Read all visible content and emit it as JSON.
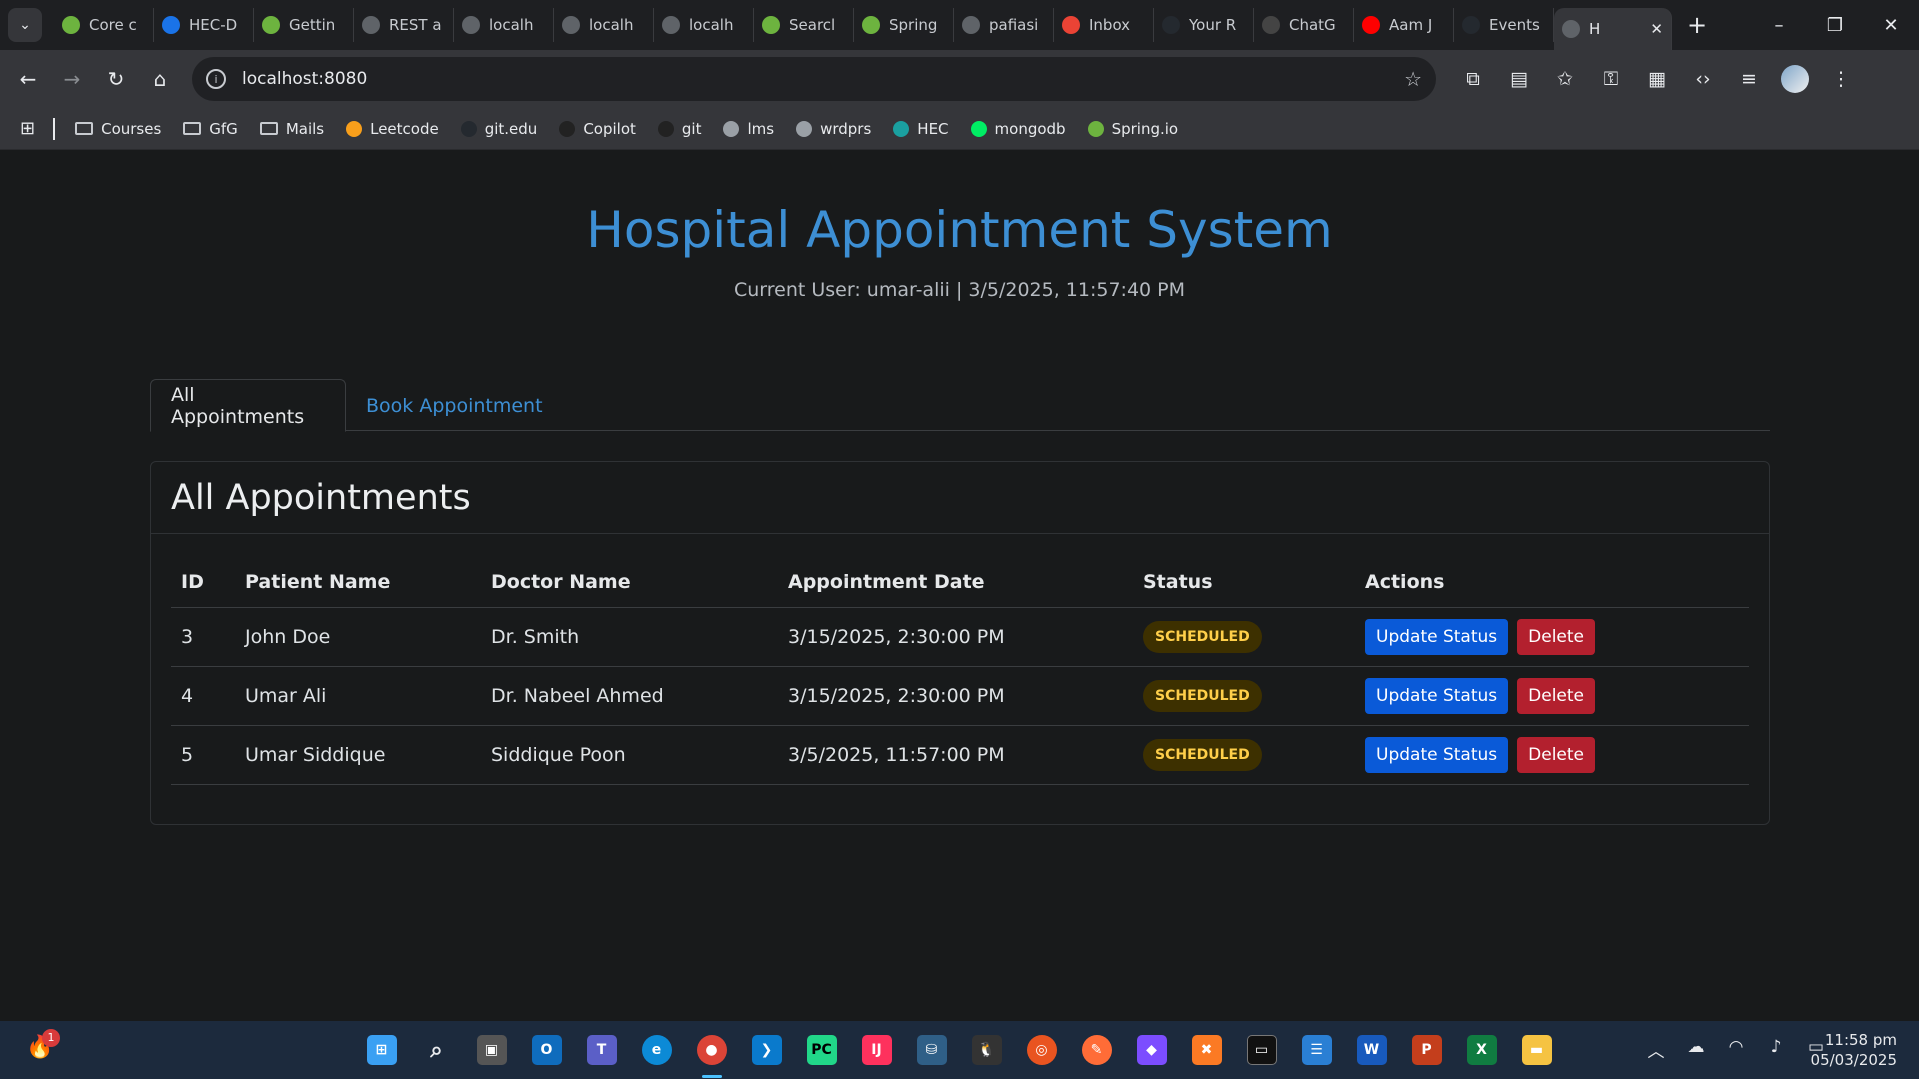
{
  "browser": {
    "tabs": [
      {
        "label": "Core c",
        "icon": "spring-icon",
        "color": "#6db33f"
      },
      {
        "label": "HEC-D",
        "icon": "c-icon",
        "color": "#1a73e8"
      },
      {
        "label": "Gettin",
        "icon": "spring-icon",
        "color": "#6db33f"
      },
      {
        "label": "REST a",
        "icon": "generic-icon",
        "color": "#5f6368"
      },
      {
        "label": "localh",
        "icon": "globe-icon",
        "color": "#5f6368"
      },
      {
        "label": "localh",
        "icon": "globe-icon",
        "color": "#5f6368"
      },
      {
        "label": "localh",
        "icon": "globe-icon",
        "color": "#5f6368"
      },
      {
        "label": "Searcl",
        "icon": "spring-icon",
        "color": "#6db33f"
      },
      {
        "label": "Spring",
        "icon": "spring-icon",
        "color": "#6db33f"
      },
      {
        "label": "pafiasi",
        "icon": "globe-icon",
        "color": "#5f6368"
      },
      {
        "label": "Inbox",
        "icon": "gmail-icon",
        "color": "#ea4335"
      },
      {
        "label": "Your R",
        "icon": "github-icon",
        "color": "#24292f"
      },
      {
        "label": "ChatG",
        "icon": "openai-icon",
        "color": "#444"
      },
      {
        "label": "Aam J",
        "icon": "youtube-icon",
        "color": "#ff0000"
      },
      {
        "label": "Events",
        "icon": "github-icon",
        "color": "#24292f"
      }
    ],
    "active_tab": {
      "label": "H",
      "close": "✕"
    },
    "new_tab": "+",
    "url": "localhost:8080",
    "bookmarks": [
      {
        "label": "Courses",
        "type": "folder"
      },
      {
        "label": "GfG",
        "type": "folder"
      },
      {
        "label": "Mails",
        "type": "folder"
      },
      {
        "label": "Leetcode",
        "type": "leetcode",
        "color": "#f89f1b"
      },
      {
        "label": "git.edu",
        "type": "github",
        "color": "#24292f"
      },
      {
        "label": "Copilot",
        "type": "copilot",
        "color": "#222"
      },
      {
        "label": "git",
        "type": "github",
        "color": "#222"
      },
      {
        "label": "lms",
        "type": "globe",
        "color": "#9aa0a6"
      },
      {
        "label": "wrdprs",
        "type": "globe",
        "color": "#9aa0a6"
      },
      {
        "label": "HEC",
        "type": "hec",
        "color": "#1aa0a0"
      },
      {
        "label": "mongodb",
        "type": "mongodb",
        "color": "#00ed64"
      },
      {
        "label": "Spring.io",
        "type": "spring",
        "color": "#6db33f"
      }
    ]
  },
  "app": {
    "title": "Hospital Appointment System",
    "subtitle": "Current User: umar-alii | 3/5/2025, 11:57:40 PM",
    "tabs": {
      "all": "All Appointments",
      "book": "Book Appointment"
    },
    "card_title": "All Appointments",
    "columns": [
      "ID",
      "Patient Name",
      "Doctor Name",
      "Appointment Date",
      "Status",
      "Actions"
    ],
    "rows": [
      {
        "id": "3",
        "patient": "John Doe",
        "doctor": "Dr. Smith",
        "date": "3/15/2025, 2:30:00 PM",
        "status": "SCHEDULED"
      },
      {
        "id": "4",
        "patient": "Umar Ali",
        "doctor": "Dr. Nabeel Ahmed",
        "date": "3/15/2025, 2:30:00 PM",
        "status": "SCHEDULED"
      },
      {
        "id": "5",
        "patient": "Umar Siddique",
        "doctor": "Siddique Poon",
        "date": "3/5/2025, 11:57:00 PM",
        "status": "SCHEDULED"
      }
    ],
    "actions": {
      "update": "Update Status",
      "delete": "Delete"
    }
  },
  "taskbar": {
    "notification_count": "1",
    "clock_time": "11:58 pm",
    "clock_date": "05/03/2025"
  }
}
